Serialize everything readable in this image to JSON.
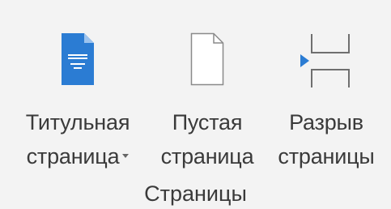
{
  "group": {
    "name": "Страницы"
  },
  "buttons": [
    {
      "line1": "Титульная",
      "line2": "страница",
      "icon": "cover-page-icon",
      "has_dropdown": true
    },
    {
      "line1": "Пустая",
      "line2": "страница",
      "icon": "blank-page-icon",
      "has_dropdown": false
    },
    {
      "line1": "Разрыв",
      "line2": "страницы",
      "icon": "page-break-icon",
      "has_dropdown": false
    }
  ],
  "colors": {
    "background": "#f3f3f3",
    "accent": "#2b7cd3",
    "text": "#3a3a3a",
    "icon_outline": "#8a8a8a"
  }
}
